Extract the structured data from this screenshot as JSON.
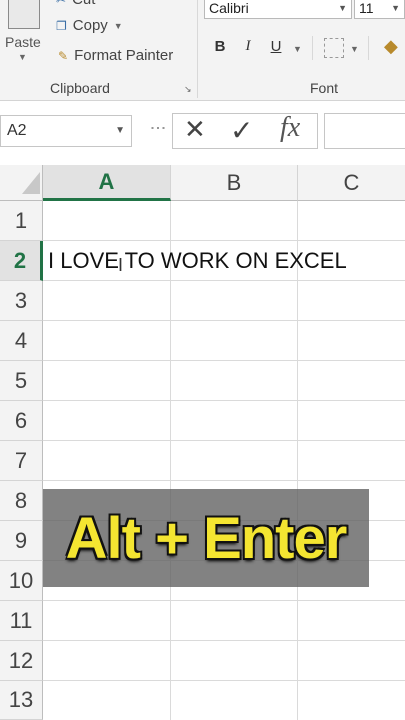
{
  "ribbon": {
    "clipboard": {
      "paste_label": "Paste",
      "cut_label": "Cut",
      "copy_label": "Copy",
      "format_painter_label": "Format Painter",
      "group_label": "Clipboard"
    },
    "font": {
      "font_name": "Calibri",
      "font_size": "11",
      "bold": "B",
      "italic": "I",
      "underline": "U",
      "group_label": "Font"
    }
  },
  "formula_bar": {
    "name_box": "A2",
    "cancel_symbol": "✕",
    "enter_symbol": "✓",
    "fx_label": "fx",
    "formula_value": ""
  },
  "grid": {
    "columns": [
      "A",
      "B",
      "C"
    ],
    "rows": [
      "1",
      "2",
      "3",
      "4",
      "5",
      "6",
      "7",
      "8",
      "9",
      "10",
      "11",
      "12",
      "13"
    ],
    "active_cell": "A2",
    "a2_value": "I LOVE TO WORK ON EXCEL"
  },
  "overlay": {
    "caption": "Alt + Enter"
  },
  "colors": {
    "accent_green": "#217346",
    "caption_yellow": "#f4e531"
  }
}
